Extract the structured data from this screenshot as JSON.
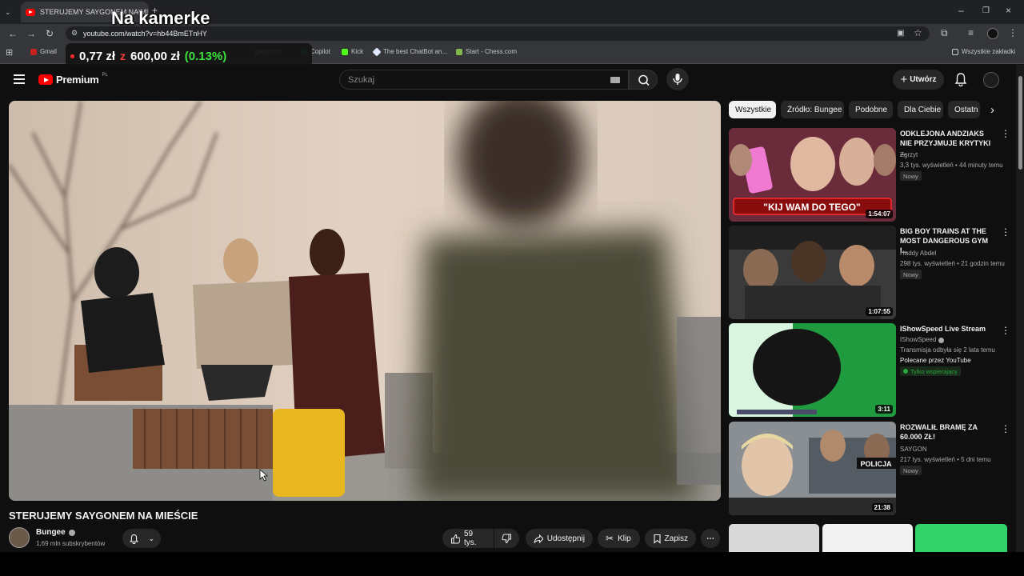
{
  "overlay": {
    "title": "Na kamerke"
  },
  "ticker": {
    "value": "0,77 zł",
    "from": "z",
    "total": "600,00 zł",
    "change": "(0.13%)"
  },
  "browser": {
    "tab_title": "STERUJEMY SAYGONEM NA MIEŚCIE",
    "url": "youtube.com/watch?v=hb44BmETnHY",
    "bookmarks": [
      "Gmail",
      "geoguser",
      "Copilot",
      "Kick",
      "The best ChatBot an...",
      "Start - Chess.com"
    ],
    "all_bookmarks": "Wszystkie zakładki"
  },
  "youtube": {
    "logo": "Premium",
    "logo_sup": "PL",
    "search_placeholder": "Szukaj",
    "create_label": "Utwórz"
  },
  "video": {
    "title": "STERUJEMY SAYGONEM NA MIEŚCIE",
    "channel": "Bungee",
    "subscribers": "1,69 mln subskrybentów",
    "likes": "59 tys.",
    "share": "Udostępnij",
    "clip": "Klip",
    "save": "Zapisz"
  },
  "chips": [
    "Wszystkie",
    "Źródło: Bungee",
    "Podobne",
    "Dla Ciebie",
    "Ostatn"
  ],
  "recommendations": [
    {
      "title": "ODKLEJONA ANDZIAKS NIE PRZYJMUJE KRYTYKI ...",
      "channel": "Zgrzyt",
      "meta": "3,3 tys. wyświetleń • 44 minuty temu",
      "badge": "Nowy",
      "duration": "1:54:07",
      "thumb_text": "\"KIJ WAM DO TEGO\""
    },
    {
      "title": "BIG BOY TRAINS AT THE MOST DANGEROUS GYM I...",
      "channel": "Haddy Abdel",
      "meta": "298 tys. wyświetleń • 21 godzin temu",
      "badge": "Nowy",
      "duration": "1:07:55"
    },
    {
      "title": "IShowSpeed Live Stream",
      "channel": "IShowSpeed",
      "meta": "Transmisja odbyła się 2 lata temu",
      "extra": "Polecane przez YouTube",
      "badge": "Tylko wspierający",
      "duration": "3:11"
    },
    {
      "title": "ROZWALIŁ BRAMĘ ZA 60.000 ZŁ!",
      "channel": "SAYGON",
      "meta": "217 tys. wyświetleń • 5 dni temu",
      "badge": "Nowy",
      "duration": "21:38",
      "thumb_text": "POLICJA"
    }
  ],
  "colors": {
    "accent": "#ff0000",
    "bg": "#0f0f0f",
    "chip_active": "#f1f1f1",
    "ticker_green": "#3be03b"
  }
}
